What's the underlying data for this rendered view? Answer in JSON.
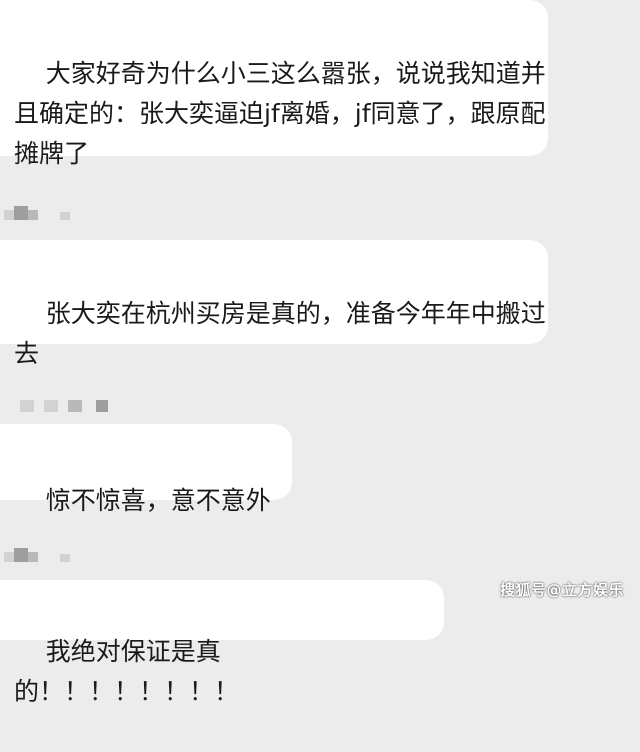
{
  "messages": [
    {
      "text": "大家好奇为什么小三这么嚣张，说说我知道并且确定的：张大奕逼迫jf离婚，jf同意了，跟原配摊牌了"
    },
    {
      "text": "张大奕在杭州买房是真的，准备今年年中搬过去"
    },
    {
      "text": "惊不惊喜，意不意外"
    },
    {
      "text": "我绝对保证是真的！！！！！！！！"
    }
  ],
  "watermark": "搜狐号@立方娱乐"
}
